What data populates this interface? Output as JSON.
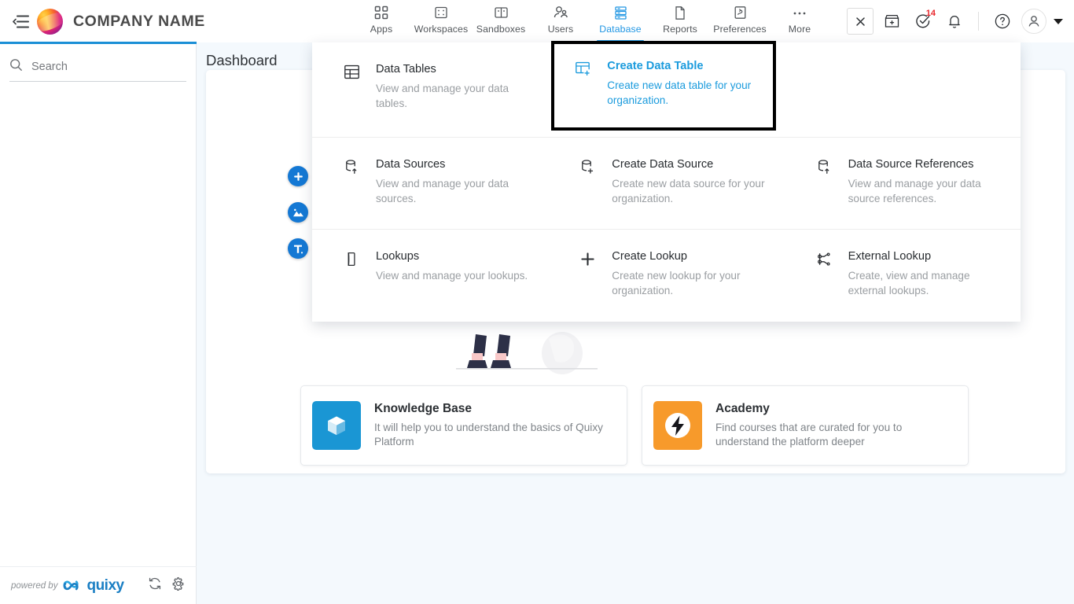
{
  "brand": {
    "name": "COMPANY NAME",
    "collapse_icon": "collapse-menu-icon",
    "logo_icon": "company-logo-icon"
  },
  "topnav": {
    "items": [
      {
        "label": "Apps",
        "icon": "apps-grid-icon",
        "active": false
      },
      {
        "label": "Workspaces",
        "icon": "workspaces-icon",
        "active": false
      },
      {
        "label": "Sandboxes",
        "icon": "sandboxes-icon",
        "active": false
      },
      {
        "label": "Users",
        "icon": "users-icon",
        "active": false
      },
      {
        "label": "Database",
        "icon": "database-icon",
        "active": true
      },
      {
        "label": "Reports",
        "icon": "reports-document-icon",
        "active": false
      },
      {
        "label": "Preferences",
        "icon": "preferences-icon",
        "active": false
      },
      {
        "label": "More",
        "icon": "more-ellipsis-icon",
        "active": false
      }
    ],
    "right_icons": [
      {
        "name": "close-icon",
        "badge": ""
      },
      {
        "name": "marketplace-store-icon",
        "badge": ""
      },
      {
        "name": "tasks-check-icon",
        "badge": "14"
      },
      {
        "name": "notifications-bell-icon",
        "badge": ""
      },
      {
        "name": "help-question-icon",
        "badge": ""
      },
      {
        "name": "user-avatar-icon",
        "badge": ""
      },
      {
        "name": "chevron-down-icon",
        "badge": ""
      }
    ]
  },
  "sidebar": {
    "search": {
      "placeholder": "Search",
      "value": "",
      "icon": "search-icon"
    },
    "footer": {
      "powered_by": "powered by",
      "product_name": "quixy",
      "icons": [
        {
          "name": "refresh-icon"
        },
        {
          "name": "settings-gear-icon"
        }
      ]
    }
  },
  "main": {
    "page_title": "Dashboard",
    "fabs": [
      {
        "name": "add-widget-fab",
        "glyph": "+"
      },
      {
        "name": "add-image-fab",
        "glyph": "image"
      },
      {
        "name": "add-text-fab",
        "glyph": "T"
      }
    ],
    "cards": [
      {
        "title": "Knowledge Base",
        "desc": "It will help you to understand the basics of Quixy Platform",
        "icon": "knowledge-base-cube-icon",
        "color": "#1a96d4"
      },
      {
        "title": "Academy",
        "desc": "Find courses that are curated for you to understand the platform deeper",
        "icon": "academy-lightning-icon",
        "color": "#f79a2b"
      }
    ]
  },
  "database_menu": {
    "rows": [
      [
        {
          "title": "Data Tables",
          "desc": "View and manage your data tables.",
          "icon": "data-table-icon",
          "highlighted": false
        },
        {
          "title": "Create Data Table",
          "desc": "Create new data table for your organization.",
          "icon": "create-data-table-icon",
          "highlighted": true
        },
        {
          "title": "",
          "desc": "",
          "icon": "",
          "highlighted": false
        }
      ],
      [
        {
          "title": "Data Sources",
          "desc": "View and manage your data sources.",
          "icon": "data-source-icon",
          "highlighted": false
        },
        {
          "title": "Create Data Source",
          "desc": "Create new data source for your organization.",
          "icon": "create-data-source-icon",
          "highlighted": false
        },
        {
          "title": "Data Source References",
          "desc": "View and manage your data source references.",
          "icon": "data-source-reference-icon",
          "highlighted": false
        }
      ],
      [
        {
          "title": "Lookups",
          "desc": "View and manage your lookups.",
          "icon": "lookup-icon",
          "highlighted": false
        },
        {
          "title": "Create Lookup",
          "desc": "Create new lookup for your organization.",
          "icon": "plus-icon",
          "highlighted": false
        },
        {
          "title": "External Lookup",
          "desc": "Create, view and manage external lookups.",
          "icon": "external-lookup-icon",
          "highlighted": false
        }
      ]
    ]
  },
  "colors": {
    "accent": "#1b8fd6",
    "highlight_link": "#1b9bdd",
    "badge_red": "#e8262b",
    "background": "#f4f9fd"
  }
}
